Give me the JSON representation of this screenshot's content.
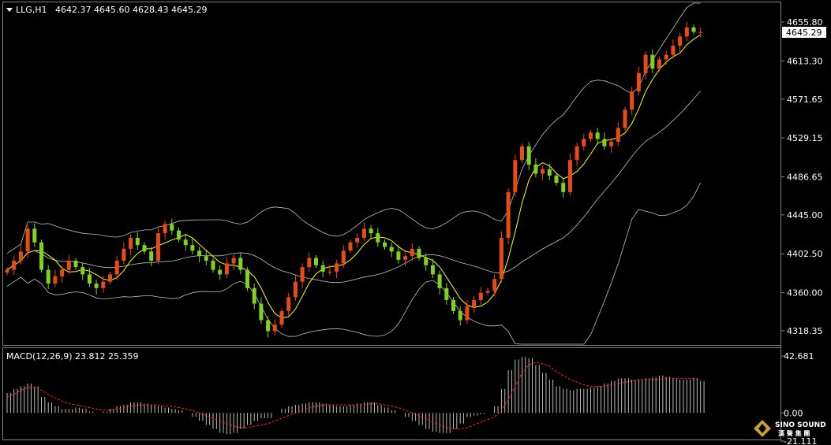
{
  "header": {
    "symbol": "LLG,H1",
    "ohlc": "4642.37 4645.60 4628.43 4645.29"
  },
  "price_axis": {
    "ticks": [
      "4655.80",
      "4613.30",
      "4571.65",
      "4529.15",
      "4486.65",
      "4445.00",
      "4402.50",
      "4360.00",
      "4318.35"
    ],
    "current_price": "4645.29"
  },
  "macd": {
    "label": "MACD(12,26,9) 23.812 25.359",
    "ticks": [
      "42.681",
      "0.00",
      "-21.111"
    ]
  },
  "logo": {
    "name": "SINO SOUND",
    "sub": "漢 聲 集 團"
  },
  "colors": {
    "background": "#000000",
    "up_candle": "#e84a1a",
    "down_candle": "#7ed321",
    "ma_line": "#ffff00",
    "bands": "#c0c0c0",
    "macd_signal": "#ff2020",
    "grid": "#808080"
  },
  "chart_data": {
    "type": "candlestick",
    "title": "LLG,H1",
    "ylim": [
      4306,
      4668
    ],
    "price_series": [
      4385,
      4395,
      4405,
      4430,
      4415,
      4385,
      4370,
      4378,
      4385,
      4395,
      4388,
      4380,
      4370,
      4365,
      4372,
      4380,
      4395,
      4408,
      4420,
      4412,
      4405,
      4395,
      4425,
      4435,
      4428,
      4418,
      4412,
      4406,
      4400,
      4395,
      4385,
      4380,
      4392,
      4398,
      4385,
      4365,
      4348,
      4330,
      4318,
      4325,
      4340,
      4355,
      4372,
      4388,
      4398,
      4390,
      4383,
      4383,
      4392,
      4406,
      4415,
      4420,
      4430,
      4425,
      4415,
      4410,
      4405,
      4396,
      4400,
      4408,
      4398,
      4390,
      4380,
      4365,
      4352,
      4340,
      4330,
      4345,
      4352,
      4360,
      4362,
      4375,
      4420,
      4470,
      4505,
      4520,
      4500,
      4490,
      4495,
      4488,
      4480,
      4470,
      4505,
      4520,
      4528,
      4535,
      4528,
      4520,
      4525,
      4540,
      4560,
      4580,
      4600,
      4620,
      4605,
      4615,
      4620,
      4630,
      4640,
      4650,
      4645,
      4645
    ],
    "macd_values": [
      15,
      18,
      20,
      22,
      20,
      12,
      8,
      5,
      3,
      3,
      4,
      3,
      1,
      0,
      1,
      3,
      5,
      6,
      8,
      8,
      7,
      6,
      5,
      4,
      3,
      2,
      0,
      -3,
      -6,
      -9,
      -12,
      -15,
      -16,
      -15,
      -12,
      -9,
      -6,
      -4,
      -4,
      0,
      3,
      5,
      6,
      7,
      8,
      8,
      7,
      6,
      5,
      5,
      6,
      7,
      8,
      8,
      6,
      4,
      2,
      0,
      -3,
      -6,
      -9,
      -12,
      -14,
      -15,
      -15,
      -12,
      -8,
      -3,
      -2,
      -1,
      0,
      5,
      18,
      32,
      40,
      42,
      41,
      36,
      30,
      25,
      20,
      18,
      17,
      18,
      18,
      19,
      20,
      22,
      24,
      26,
      26,
      25,
      25,
      26,
      27,
      28,
      27,
      26,
      25,
      25,
      26,
      24
    ],
    "macd_signal": [
      12,
      14,
      17,
      19,
      19,
      17,
      14,
      11,
      9,
      7,
      6,
      5,
      4,
      3,
      2,
      2,
      3,
      4,
      5,
      6,
      6,
      6,
      6,
      5,
      5,
      4,
      3,
      2,
      0,
      -2,
      -4,
      -6,
      -8,
      -10,
      -11,
      -11,
      -10,
      -9,
      -8,
      -6,
      -4,
      -2,
      0,
      2,
      4,
      5,
      6,
      6,
      6,
      6,
      6,
      6,
      6,
      7,
      7,
      6,
      5,
      4,
      2,
      0,
      -2,
      -4,
      -7,
      -9,
      -11,
      -12,
      -12,
      -11,
      -9,
      -7,
      -5,
      -3,
      2,
      10,
      20,
      30,
      36,
      38,
      37,
      35,
      31,
      28,
      25,
      23,
      21,
      20,
      20,
      20,
      21,
      22,
      23,
      24,
      25,
      25,
      25,
      25,
      26,
      26,
      26,
      26,
      26,
      25
    ]
  }
}
